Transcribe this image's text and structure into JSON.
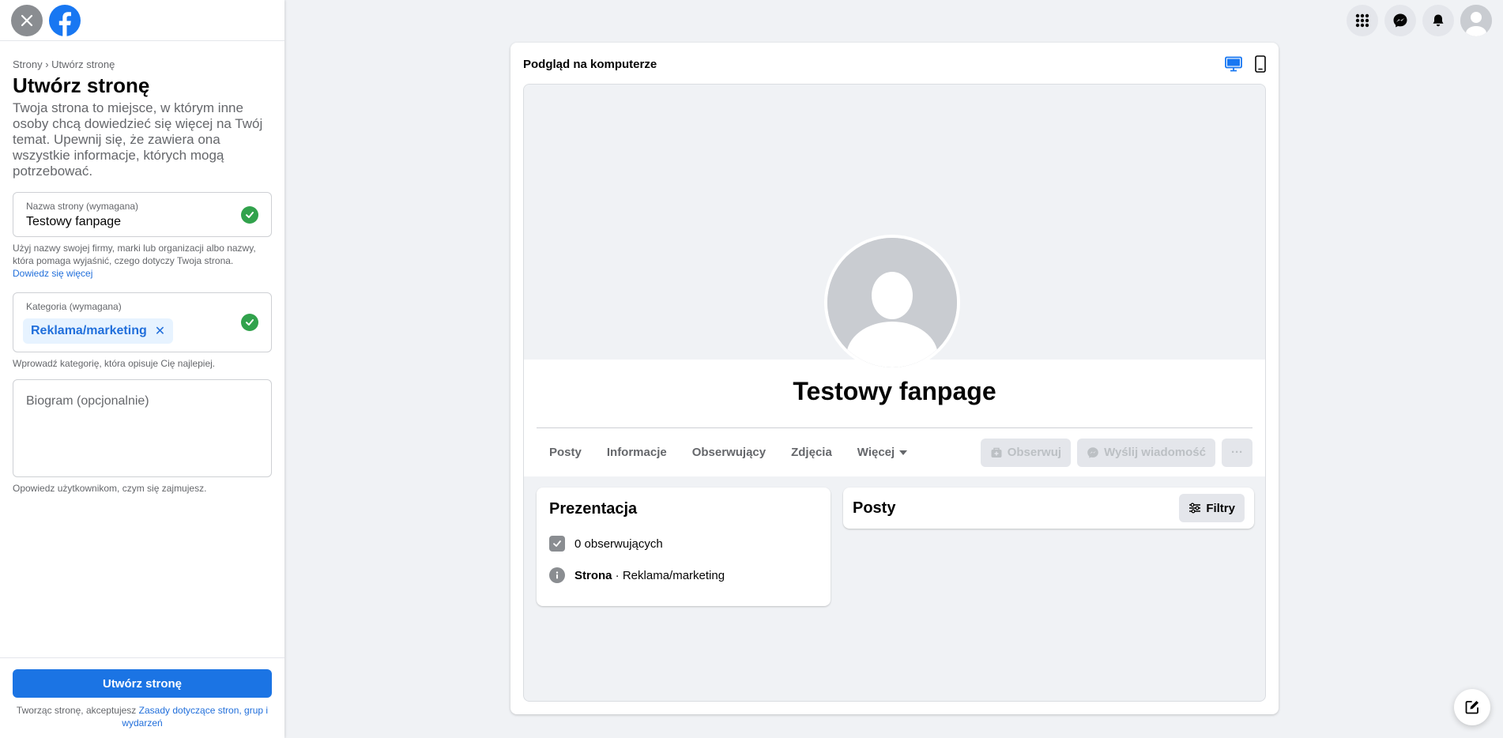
{
  "left_panel": {
    "breadcrumb": {
      "parent": "Strony",
      "separator": "›",
      "current": "Utwórz stronę"
    },
    "title": "Utwórz stronę",
    "description": "Twoja strona to miejsce, w którym inne osoby chcą dowiedzieć się więcej na Twój temat. Upewnij się, że zawiera ona wszystkie informacje, których mogą potrzebować.",
    "name_field": {
      "label": "Nazwa strony (wymagana)",
      "value": "Testowy fanpage"
    },
    "name_helper": "Użyj nazwy swojej firmy, marki lub organizacji albo nazwy, która pomaga wyjaśnić, czego dotyczy Twoja strona.",
    "name_helper_link": "Dowiedz się więcej",
    "category_field": {
      "label": "Kategoria (wymagana)",
      "chip": "Reklama/marketing"
    },
    "category_helper": "Wprowadź kategorię, która opisuje Cię najlepiej.",
    "bio_field": {
      "placeholder": "Biogram (opcjonalnie)",
      "value": ""
    },
    "bio_helper": "Opowiedz użytkownikom, czym się zajmujesz.",
    "create_button": "Utwórz stronę",
    "terms_text": "Tworząc stronę, akceptujesz",
    "terms_link": "Zasady dotyczące stron, grup i wydarzeń"
  },
  "preview": {
    "title": "Podgląd na komputerze",
    "page_name": "Testowy fanpage",
    "tabs": [
      {
        "label": "Posty"
      },
      {
        "label": "Informacje"
      },
      {
        "label": "Obserwujący"
      },
      {
        "label": "Zdjęcia"
      },
      {
        "label": "Więcej"
      }
    ],
    "actions": {
      "follow": "Obserwuj",
      "message": "Wyślij wiadomość",
      "more": "···"
    },
    "intro": {
      "title": "Prezentacja",
      "followers": "0 obserwujących",
      "type_bold": "Strona",
      "type_rest": " · Reklama/marketing"
    },
    "posts": {
      "title": "Posty",
      "filter": "Filtry"
    }
  },
  "colors": {
    "primary": "#1b74e4",
    "link": "#216fdb",
    "success": "#31a24c",
    "background": "#f0f2f5"
  },
  "icons": [
    "close-icon",
    "facebook-logo",
    "menu-grid-icon",
    "messenger-icon",
    "notifications-icon",
    "account-avatar",
    "desktop-icon",
    "mobile-icon",
    "check-icon",
    "compose-icon"
  ]
}
